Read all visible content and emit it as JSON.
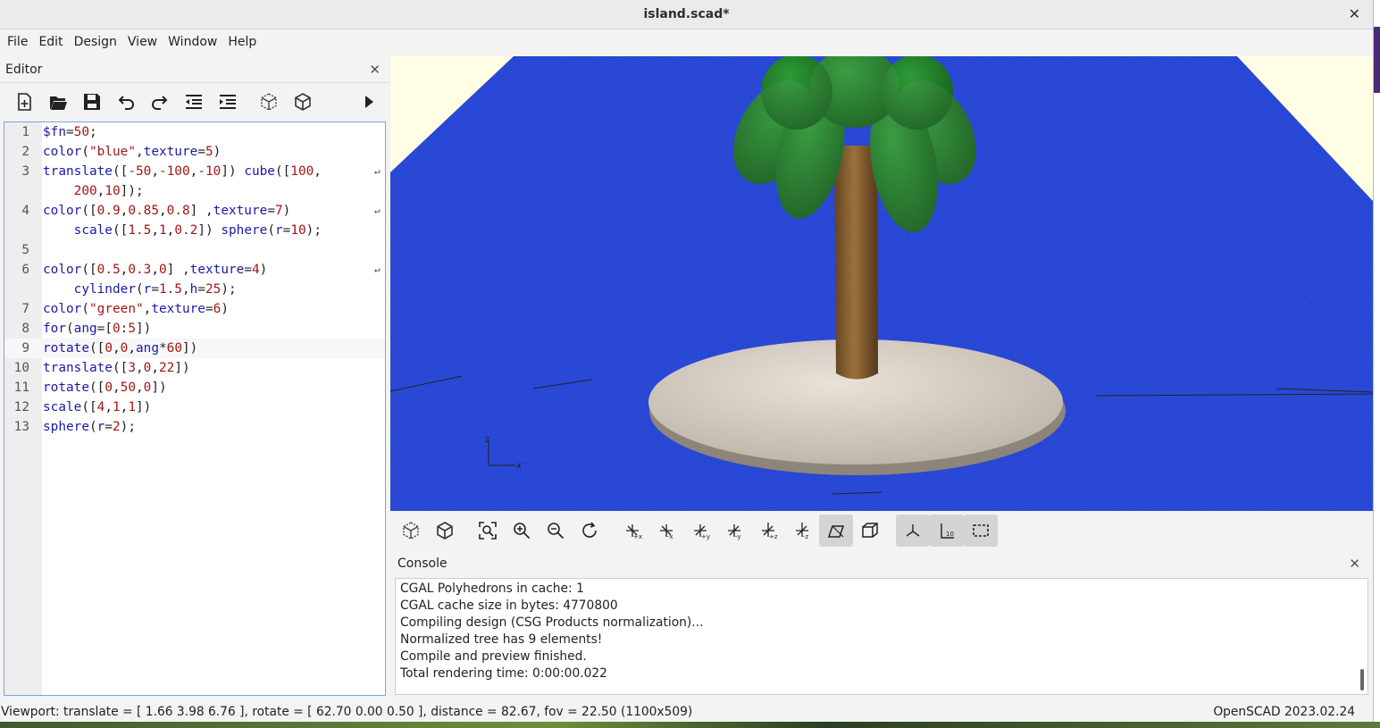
{
  "window": {
    "title": "island.scad*",
    "close_icon": "close-icon"
  },
  "menubar": [
    "File",
    "Edit",
    "Design",
    "View",
    "Window",
    "Help"
  ],
  "editor": {
    "title": "Editor",
    "toolbar": [
      "new-file-icon",
      "open-file-icon",
      "save-icon",
      "undo-icon",
      "redo-icon",
      "unindent-icon",
      "indent-icon",
      "preview-icon",
      "render-icon",
      "send-to-printer-arrow-icon"
    ],
    "lines": [
      {
        "n": "1",
        "t": "$fn=50;"
      },
      {
        "n": "2",
        "t": "color(\"blue\",texture=5)"
      },
      {
        "n": "3",
        "t": "translate([-50,-100,-10]) cube([100,",
        "wrap": true
      },
      {
        "n": "",
        "t": "    200,10]);"
      },
      {
        "n": "4",
        "t": "color([0.9,0.85,0.8] ,texture=7)",
        "wrap": true
      },
      {
        "n": "",
        "t": "    scale([1.5,1,0.2]) sphere(r=10);"
      },
      {
        "n": "5",
        "t": ""
      },
      {
        "n": "6",
        "t": "color([0.5,0.3,0] ,texture=4)",
        "wrap": true
      },
      {
        "n": "",
        "t": "    cylinder(r=1.5,h=25);"
      },
      {
        "n": "7",
        "t": "color(\"green\",texture=6)"
      },
      {
        "n": "8",
        "t": "for(ang=[0:5])"
      },
      {
        "n": "9",
        "t": "rotate([0,0,ang*60])",
        "current": true
      },
      {
        "n": "10",
        "t": "translate([3,0,22])"
      },
      {
        "n": "11",
        "t": "rotate([0,50,0])"
      },
      {
        "n": "12",
        "t": "scale([4,1,1])"
      },
      {
        "n": "13",
        "t": "sphere(r=2);"
      }
    ]
  },
  "viewport": {
    "colors": {
      "water": "#1538d8",
      "sand": "#d8d0c4",
      "trunk": "#7a5020",
      "leaves": "#1f7a28",
      "background": "#fffde4"
    },
    "axis_labels": [
      "x",
      "z"
    ]
  },
  "view_toolbar": [
    "preview-icon",
    "render-icon",
    "view-all-icon",
    "zoom-in-icon",
    "zoom-out-icon",
    "reset-view-icon",
    "right-view-icon",
    "left-view-icon",
    "back-view-icon",
    "front-view-icon",
    "top-view-icon",
    "bottom-view-icon",
    "perspective-icon",
    "orthogonal-icon",
    "show-axes-icon",
    "show-scale-markers-icon",
    "show-edges-icon"
  ],
  "console": {
    "title": "Console",
    "lines": [
      "CGAL Polyhedrons in cache: 1",
      "CGAL cache size in bytes: 4770800",
      "Compiling design (CSG Products normalization)...",
      "Normalized tree has 9 elements!",
      "Compile and preview finished.",
      "Total rendering time: 0:00:00.022"
    ]
  },
  "statusbar": {
    "viewport_info": "Viewport: translate = [ 1.66 3.98 6.76 ], rotate = [ 62.70 0.00 0.50 ], distance = 82.67, fov = 22.50 (1100x509)",
    "version": "OpenSCAD 2023.02.24"
  }
}
